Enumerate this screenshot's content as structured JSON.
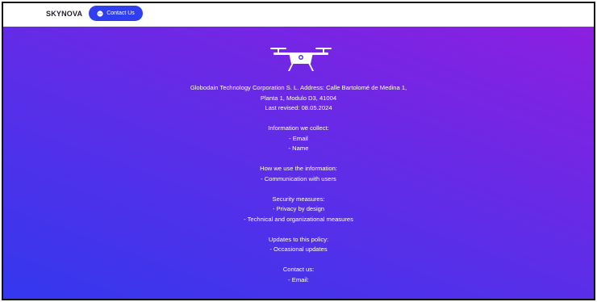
{
  "header": {
    "brand": "SKYNOVA",
    "contact_label": "Contact Us"
  },
  "icons": {
    "logo": "drone-icon",
    "contact": "chat-bubble-icon"
  },
  "colors": {
    "button": "#2f3ff0",
    "gradient_start": "#3338ee",
    "gradient_end": "#8c1fe0"
  },
  "policy": {
    "address_line1": "Globodain Technology Corporation S. L. Address: Calle Bartolomé de Medina 1,",
    "address_line2": "Planta 1, Modulo D3, 41004",
    "last_revised": "Last revised: 08.05.2024",
    "collect_title": "Information we collect:",
    "collect_items": [
      "- Email",
      "- Name"
    ],
    "use_title": "How we use the information:",
    "use_items": [
      "- Communication with users"
    ],
    "security_title": "Security measures:",
    "security_items": [
      "- Privacy by design",
      "- Technical and organizational measures"
    ],
    "updates_title": "Updates to this policy:",
    "updates_items": [
      "- Occasional updates"
    ],
    "contact_title": "Contact us:",
    "contact_items": [
      "- Email:"
    ]
  }
}
